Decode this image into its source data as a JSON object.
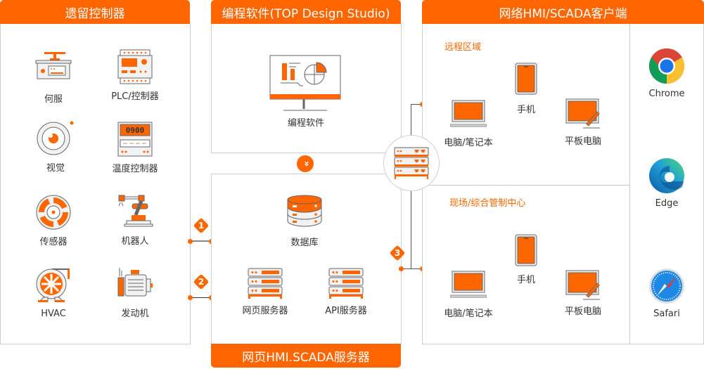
{
  "panels": {
    "legacy": {
      "title": "遗留控制器",
      "items": [
        {
          "label": "何服",
          "icon": "servo-drive-icon"
        },
        {
          "label": "PLC/控制器",
          "icon": "plc-icon"
        },
        {
          "label": "视觉",
          "icon": "vision-camera-icon"
        },
        {
          "label": "温度控制器",
          "icon": "temperature-controller-icon",
          "display": "0900"
        },
        {
          "label": "传感器",
          "icon": "sensor-icon"
        },
        {
          "label": "机器人",
          "icon": "robot-arm-icon"
        },
        {
          "label": "HVAC",
          "icon": "hvac-fan-icon"
        },
        {
          "label": "发动机",
          "icon": "motor-icon"
        }
      ]
    },
    "software": {
      "title": "编程软件(TOP Design Studio)",
      "item": {
        "label": "编程软件",
        "icon": "monitor-chart-icon"
      }
    },
    "server": {
      "title": "网页HMI.SCADA服务器",
      "items": [
        {
          "label": "数据库",
          "icon": "database-icon"
        },
        {
          "label": "网页服务器",
          "icon": "server-rack-icon"
        },
        {
          "label": "API服务器",
          "icon": "server-rack-icon"
        }
      ]
    },
    "client": {
      "title": "网络HMI/SCADA客户端",
      "zones": [
        {
          "title": "远程区域",
          "devices": [
            {
              "label": "电脑/笔记本",
              "icon": "laptop-icon"
            },
            {
              "label": "手机",
              "icon": "phone-icon"
            },
            {
              "label": "平板电脑",
              "icon": "tablet-icon"
            }
          ]
        },
        {
          "title": "现场/综合管制中心",
          "devices": [
            {
              "label": "电脑/笔记本",
              "icon": "laptop-icon"
            },
            {
              "label": "手机",
              "icon": "phone-icon"
            },
            {
              "label": "平板电脑",
              "icon": "tablet-icon"
            }
          ]
        }
      ],
      "browsers": [
        {
          "label": "Chrome",
          "icon": "chrome-icon"
        },
        {
          "label": "Edge",
          "icon": "edge-icon"
        },
        {
          "label": "Safari",
          "icon": "safari-icon"
        }
      ]
    }
  },
  "badges": [
    "1",
    "2",
    "3"
  ],
  "colors": {
    "accent": "#ff6600",
    "border": "#cfcfcf"
  }
}
